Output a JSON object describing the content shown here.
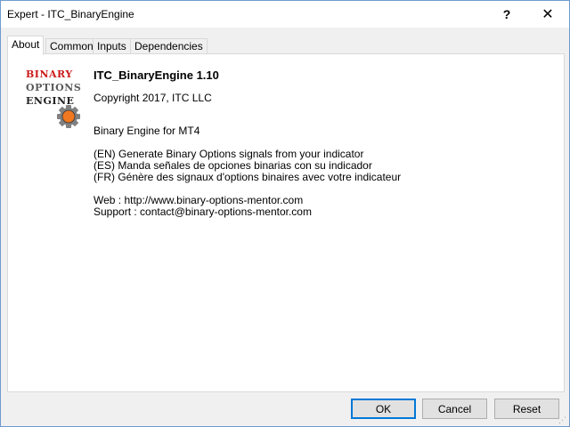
{
  "window": {
    "title": "Expert - ITC_BinaryEngine",
    "help_label": "?",
    "close_label": "✕"
  },
  "tabs": [
    {
      "label": "About",
      "active": true
    },
    {
      "label": "Common"
    },
    {
      "label": "Inputs"
    },
    {
      "label": "Dependencies"
    }
  ],
  "logo": {
    "line1": "BINARY",
    "line2": "OPTIONS",
    "line3": "ENGINE",
    "icon": "gear-icon",
    "colors": {
      "red": "#cc1a1a",
      "orange": "#f07820",
      "gray": "#808080"
    }
  },
  "about": {
    "title": "ITC_BinaryEngine 1.10",
    "copyright": "Copyright 2017, ITC LLC",
    "description": "Binary Engine for MT4",
    "lines": [
      "(EN) Generate Binary Options signals from your indicator",
      "(ES) Manda señales de opciones binarias con su indicador",
      "(FR) Génère des signaux d'options binaires avec votre indicateur"
    ],
    "web": "Web : http://www.binary-options-mentor.com",
    "support": "Support : contact@binary-options-mentor.com"
  },
  "buttons": {
    "ok": "OK",
    "cancel": "Cancel",
    "reset": "Reset"
  }
}
